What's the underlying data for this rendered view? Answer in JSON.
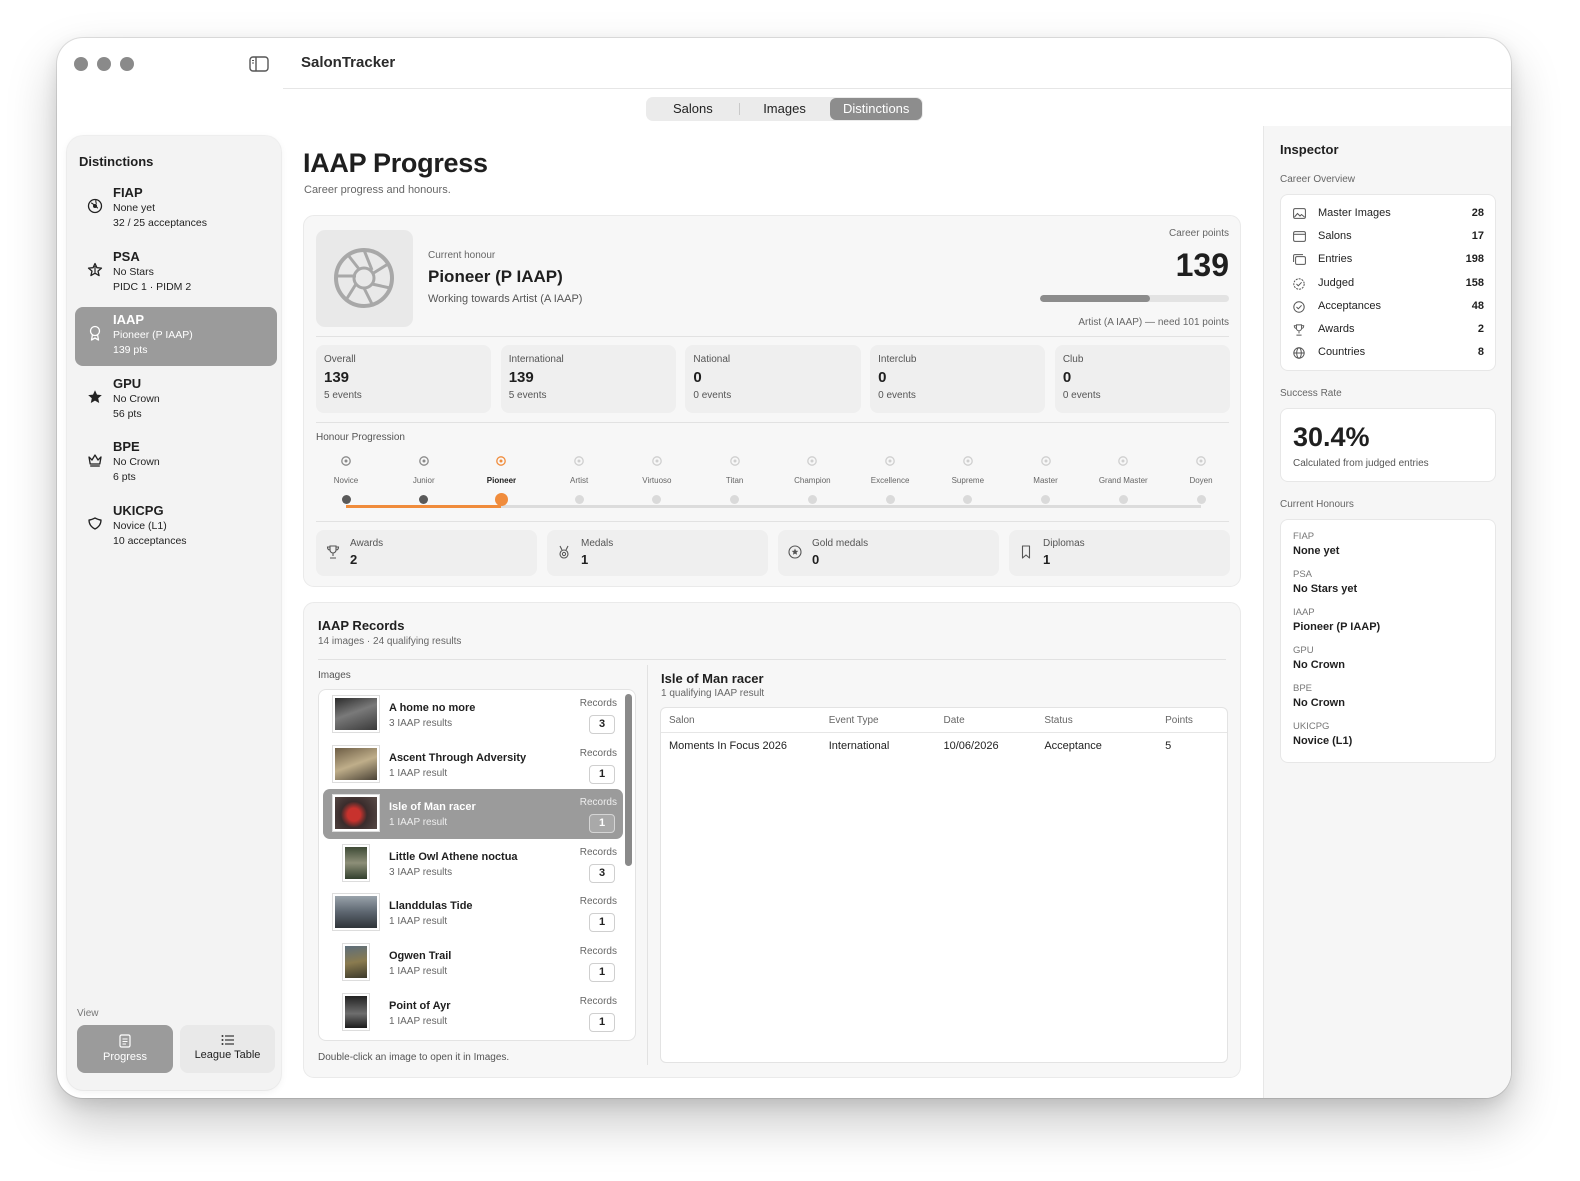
{
  "app": {
    "title": "SalonTracker"
  },
  "tabs": [
    {
      "label": "Salons",
      "active": false
    },
    {
      "label": "Images",
      "active": false
    },
    {
      "label": "Distinctions",
      "active": true
    }
  ],
  "sidebar": {
    "title": "Distinctions",
    "items": [
      {
        "name": "FIAP",
        "line1": "None yet",
        "line2": "32 / 25 acceptances",
        "icon": "globe-icon",
        "selected": false
      },
      {
        "name": "PSA",
        "line1": "No Stars",
        "line2": "PIDC 1 · PIDM 2",
        "icon": "star-outline-icon",
        "selected": false
      },
      {
        "name": "IAAP",
        "line1": "Pioneer (P IAAP)",
        "line2": "139 pts",
        "icon": "medal-icon",
        "selected": true
      },
      {
        "name": "GPU",
        "line1": "No Crown",
        "line2": "56 pts",
        "icon": "star-filled-icon",
        "selected": false
      },
      {
        "name": "BPE",
        "line1": "No Crown",
        "line2": "6 pts",
        "icon": "crown-icon",
        "selected": false
      },
      {
        "name": "UKICPG",
        "line1": "Novice (L1)",
        "line2": "10 acceptances",
        "icon": "shield-icon",
        "selected": false
      }
    ],
    "view_label": "View",
    "view_buttons": [
      {
        "label": "Progress",
        "active": true
      },
      {
        "label": "League Table",
        "active": false
      }
    ]
  },
  "main": {
    "title": "IAAP Progress",
    "subtitle": "Career progress and honours.",
    "current_honour_label": "Current honour",
    "current_honour": "Pioneer (P IAAP)",
    "working_towards": "Working towards Artist (A IAAP)",
    "career_points_label": "Career points",
    "career_points": "139",
    "career_progress": 0.58,
    "next_need": "Artist (A IAAP) — need 101 points",
    "levels": [
      {
        "name": "Overall",
        "value": "139",
        "events": "5 events"
      },
      {
        "name": "International",
        "value": "139",
        "events": "5 events"
      },
      {
        "name": "National",
        "value": "0",
        "events": "0 events"
      },
      {
        "name": "Interclub",
        "value": "0",
        "events": "0 events"
      },
      {
        "name": "Club",
        "value": "0",
        "events": "0 events"
      }
    ],
    "honour_progression_label": "Honour Progression",
    "progression": [
      "Novice",
      "Junior",
      "Pioneer",
      "Artist",
      "Virtuoso",
      "Titan",
      "Champion",
      "Excellence",
      "Supreme",
      "Master",
      "Grand Master",
      "Doyen"
    ],
    "progression_current_index": 2,
    "awards": [
      {
        "name": "Awards",
        "value": "2",
        "icon": "trophy-icon"
      },
      {
        "name": "Medals",
        "value": "1",
        "icon": "medal-icon"
      },
      {
        "name": "Gold medals",
        "value": "0",
        "icon": "gold-medal-icon"
      },
      {
        "name": "Diplomas",
        "value": "1",
        "icon": "bookmark-icon"
      }
    ],
    "records": {
      "title": "IAAP Records",
      "subtitle": "14 images · 24 qualifying results",
      "images_label": "Images",
      "records_label": "Records",
      "hint": "Double-click an image to open it in Images.",
      "images": [
        {
          "title": "A home no more",
          "sub": "3 IAAP results",
          "count": "3",
          "selected": false
        },
        {
          "title": "Ascent Through Adversity",
          "sub": "1 IAAP result",
          "count": "1",
          "selected": false
        },
        {
          "title": "Isle of Man racer",
          "sub": "1 IAAP result",
          "count": "1",
          "selected": true
        },
        {
          "title": "Little Owl Athene noctua",
          "sub": "3 IAAP results",
          "count": "3",
          "selected": false
        },
        {
          "title": "Llanddulas Tide",
          "sub": "1 IAAP result",
          "count": "1",
          "selected": false
        },
        {
          "title": "Ogwen Trail",
          "sub": "1 IAAP result",
          "count": "1",
          "selected": false
        },
        {
          "title": "Point of Ayr",
          "sub": "1 IAAP result",
          "count": "1",
          "selected": false
        }
      ],
      "selected_title": "Isle of Man racer",
      "selected_sub": "1 qualifying IAAP result",
      "columns": [
        "Salon",
        "Event Type",
        "Date",
        "Status",
        "Points"
      ],
      "rows": [
        [
          "Moments In Focus 2026",
          "International",
          "10/06/2026",
          "Acceptance",
          "5"
        ]
      ]
    }
  },
  "inspector": {
    "title": "Inspector",
    "overview_label": "Career Overview",
    "overview": [
      {
        "label": "Master Images",
        "value": "28",
        "icon": "photo-icon"
      },
      {
        "label": "Salons",
        "value": "17",
        "icon": "calendar-icon"
      },
      {
        "label": "Entries",
        "value": "198",
        "icon": "photos-stack-icon"
      },
      {
        "label": "Judged",
        "value": "158",
        "icon": "check-badge-icon"
      },
      {
        "label": "Acceptances",
        "value": "48",
        "icon": "check-circle-icon"
      },
      {
        "label": "Awards",
        "value": "2",
        "icon": "trophy-icon"
      },
      {
        "label": "Countries",
        "value": "8",
        "icon": "globe-icon"
      }
    ],
    "success_label": "Success Rate",
    "success_rate": "30.4%",
    "success_sub": "Calculated from judged entries",
    "honours_label": "Current Honours",
    "honours": [
      {
        "org": "FIAP",
        "value": "None yet"
      },
      {
        "org": "PSA",
        "value": "No Stars yet"
      },
      {
        "org": "IAAP",
        "value": "Pioneer (P IAAP)"
      },
      {
        "org": "GPU",
        "value": "No Crown"
      },
      {
        "org": "BPE",
        "value": "No Crown"
      },
      {
        "org": "UKICPG",
        "value": "Novice (L1)"
      }
    ]
  },
  "colors": {
    "accent": "#f08c3c",
    "selection": "#9b9b9b"
  }
}
